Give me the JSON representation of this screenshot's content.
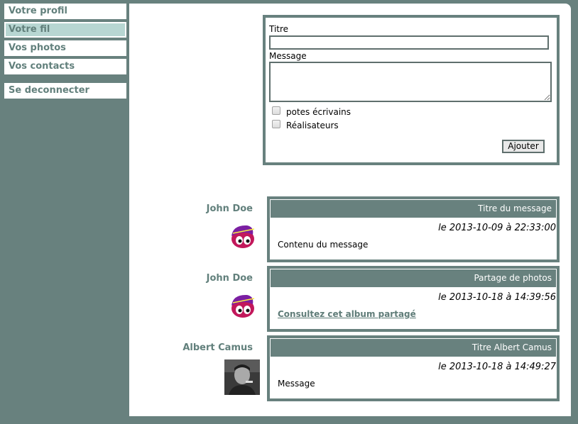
{
  "sidebar": {
    "items": [
      {
        "label": "Votre profil"
      },
      {
        "label": "Votre fil"
      },
      {
        "label": "Vos photos"
      },
      {
        "label": "Vos contacts"
      },
      {
        "label": "Se deconnecter"
      }
    ]
  },
  "form": {
    "title_label": "Titre",
    "title_value": "",
    "message_label": "Message",
    "message_value": "",
    "groups": [
      {
        "label": "potes écrivains",
        "checked": false
      },
      {
        "label": "Réalisateurs",
        "checked": false
      }
    ],
    "submit_label": "Ajouter"
  },
  "posts": [
    {
      "author": "John Doe",
      "avatar": "cartoon-face-avatar",
      "title": "Titre du message",
      "date": "le 2013-10-09 à 22:33:00",
      "body": "Contenu du message",
      "is_link": false
    },
    {
      "author": "John Doe",
      "avatar": "cartoon-face-avatar",
      "title": "Partage de photos",
      "date": "le 2013-10-18 à 14:39:56",
      "body": "Consultez cet album partagé",
      "is_link": true
    },
    {
      "author": "Albert Camus",
      "avatar": "portrait-photo-avatar",
      "title": "Titre Albert Camus",
      "date": "le 2013-10-18 à 14:49:27",
      "body": "Message",
      "is_link": false
    }
  ],
  "colors": {
    "background": "#68817e",
    "active_nav": "#b7d6d2",
    "accent_text": "#62807c"
  }
}
